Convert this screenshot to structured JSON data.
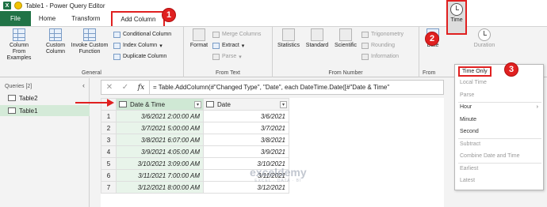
{
  "window": {
    "title": "Table1 - Power Query Editor"
  },
  "tabs": {
    "file": "File",
    "home": "Home",
    "transform": "Transform",
    "add_column": "Add Column"
  },
  "ribbon": {
    "general": {
      "label": "General",
      "column_from_examples": "Column From Examples",
      "custom_column": "Custom Column",
      "invoke_custom_function": "Invoke Custom Function",
      "conditional_column": "Conditional Column",
      "index_column": "Index Column",
      "duplicate_column": "Duplicate Column"
    },
    "from_text": {
      "label": "From Text",
      "format": "Format",
      "merge_columns": "Merge Columns",
      "extract": "Extract",
      "parse": "Parse"
    },
    "from_number": {
      "label": "From Number",
      "statistics": "Statistics",
      "standard": "Standard",
      "scientific": "Scientific",
      "trigonometry": "Trigonometry",
      "rounding": "Rounding",
      "information": "Information"
    },
    "from_date_time": {
      "label": "From",
      "date": "Date",
      "time": "Time",
      "duration": "Duration"
    }
  },
  "badges": {
    "b1": "1",
    "b2": "2",
    "b3": "3"
  },
  "queries": {
    "header": "Queries [2]",
    "items": [
      {
        "label": "Table2"
      },
      {
        "label": "Table1"
      }
    ]
  },
  "formula_bar": {
    "cancel": "✕",
    "confirm": "✓",
    "fx": "fx",
    "formula": "= Table.AddColumn(#\"Changed Type\", \"Date\", each DateTime.Date([#\"Date & Time\""
  },
  "table": {
    "columns": [
      "Date & Time",
      "Date"
    ],
    "rows": [
      {
        "n": "1",
        "dt": "3/6/2021 2:00:00 AM",
        "d": "3/6/2021"
      },
      {
        "n": "2",
        "dt": "3/7/2021 5:00:00 AM",
        "d": "3/7/2021"
      },
      {
        "n": "3",
        "dt": "3/8/2021 6:07:00 AM",
        "d": "3/8/2021"
      },
      {
        "n": "4",
        "dt": "3/9/2021 4:05:00 AM",
        "d": "3/9/2021"
      },
      {
        "n": "5",
        "dt": "3/10/2021 3:09:00 AM",
        "d": "3/10/2021"
      },
      {
        "n": "6",
        "dt": "3/11/2021 7:00:00 AM",
        "d": "3/11/2021"
      },
      {
        "n": "7",
        "dt": "3/12/2021 8:00:00 AM",
        "d": "3/12/2021"
      }
    ]
  },
  "time_menu": {
    "time_only": "Time Only",
    "local_time": "Local Time",
    "parse": "Parse",
    "hour": "Hour",
    "minute": "Minute",
    "second": "Second",
    "subtract": "Subtract",
    "combine_date_and_time": "Combine Date and Time",
    "earliest": "Earliest",
    "latest": "Latest"
  },
  "watermark": {
    "main": "exceldemy",
    "sub": "EXCEL · DATA · BI"
  },
  "colors": {
    "accent": "#217346",
    "highlight": "#e02020",
    "selected_col": "#cfe8d4"
  }
}
